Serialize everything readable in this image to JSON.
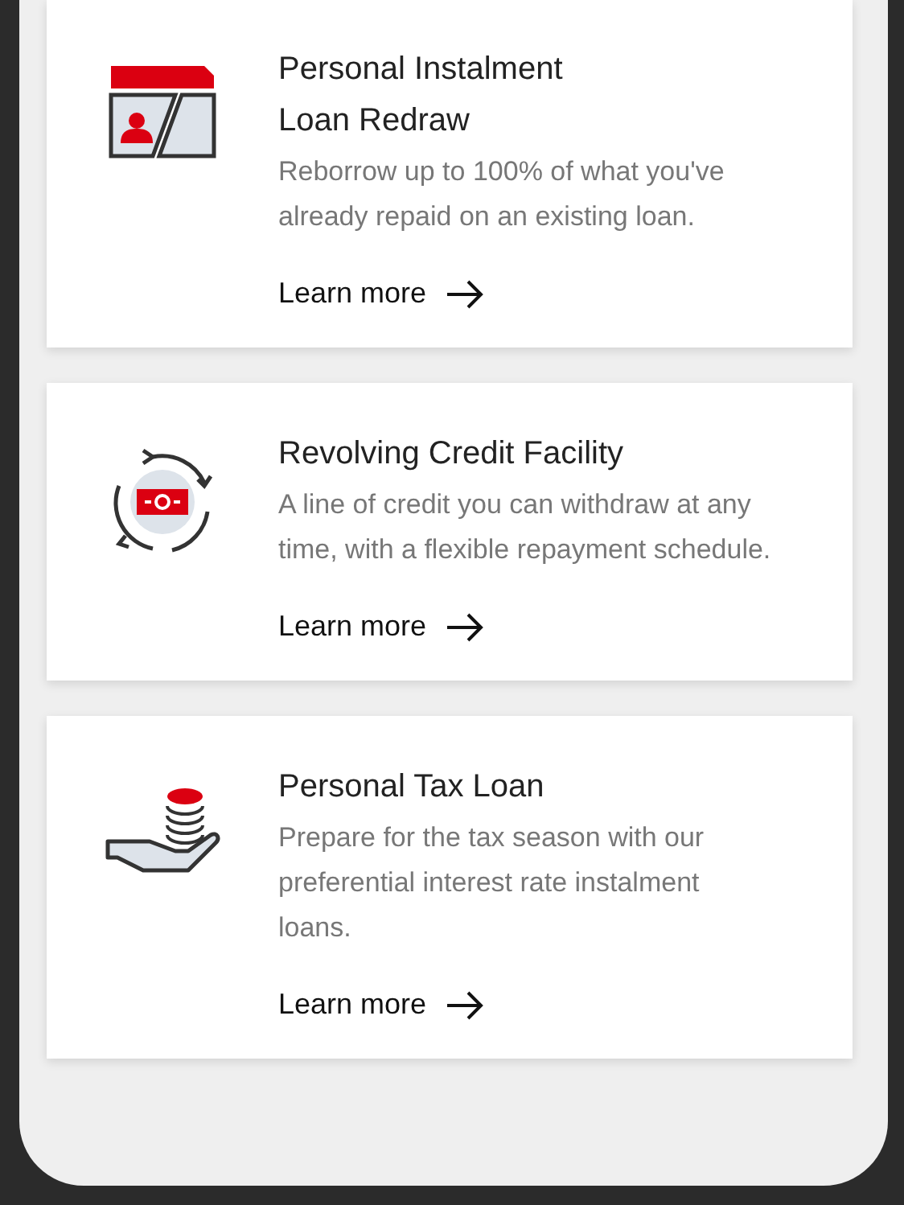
{
  "cards": [
    {
      "kind": "redraw",
      "title": "Personal Instalment\nLoan Redraw",
      "description": "Reborrow up to 100% of what you've already repaid on an existing loan.",
      "link": "Learn more"
    },
    {
      "kind": "revolving",
      "title": "Revolving Credit Facility",
      "description": "A line of credit you can withdraw at any time, with a flexible repayment schedule.",
      "link": "Learn more"
    },
    {
      "kind": "tax",
      "title": "Personal Tax Loan",
      "description": "Prepare for the tax season with our preferential interest rate instalment loans.",
      "link": "Learn more"
    }
  ]
}
